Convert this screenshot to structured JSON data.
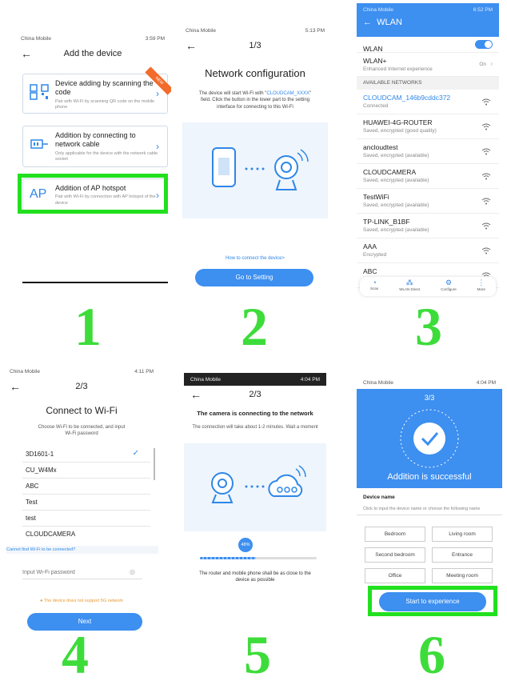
{
  "colors": {
    "accent": "#3d8ff0",
    "highlight": "#22e01f",
    "step_number": "#3ddc3a",
    "wlan_bar": "#3d8ff0"
  },
  "steps": {
    "s1": "1",
    "s2": "2",
    "s3": "3",
    "s4": "4",
    "s5": "5",
    "s6": "6"
  },
  "p1": {
    "carrier": "China Mobile",
    "time": "3:59 PM",
    "title": "Add the device",
    "cards": [
      {
        "title": "Device adding by scanning the code",
        "sub": "Pair with Wi-Fi by scanning QR code on the mobile phone",
        "badge": "NEW"
      },
      {
        "title": "Addition by connecting to network cable",
        "sub": "Only applicable for the device with the network cable socket"
      },
      {
        "title": "Addition of AP hotspot",
        "sub": "Pair with Wi-Fi by connection with AP hotspot of the device",
        "icon_text": "AP"
      }
    ]
  },
  "p2": {
    "carrier": "China Mobile",
    "time": "5:13 PM",
    "step": "1/3",
    "title": "Network configuration",
    "desc_pre": "The device will start Wi-Fi with \"",
    "desc_ssid": "CLOUDCAM_XXXX",
    "desc_post": "\" field. Click the button in the lower part to the setting interface for connecting to this Wi-Fi",
    "link": "How to connect the device>",
    "button": "Go to Setting"
  },
  "p3": {
    "carrier": "China Mobile",
    "time": "6:52 PM",
    "title": "WLAN",
    "wlan_label": "WLAN",
    "wlan_plus": "WLAN+",
    "wlan_plus_sub": "Enhanced Internet experience",
    "wlan_plus_val": "On",
    "section": "AVAILABLE NETWORKS",
    "networks": [
      {
        "name": "CLOUDCAM_146b9cddc372",
        "status": "Connected"
      },
      {
        "name": "HUAWEI-4G-ROUTER",
        "status": "Saved, encrypted (good quality)"
      },
      {
        "name": "ancloudtest",
        "status": "Saved, encrypted (available)"
      },
      {
        "name": "CLOUDCAMERA",
        "status": "Saved, encrypted (available)"
      },
      {
        "name": "TestWiFi",
        "status": "Saved, encrypted (available)"
      },
      {
        "name": "TP-LINK_B1BF",
        "status": "Saved, encrypted (available)"
      },
      {
        "name": "AAA",
        "status": "Encrypted"
      },
      {
        "name": "ABC",
        "status": "Encrypted"
      }
    ],
    "toolbar": {
      "scan": "Scan",
      "direct": "WLAN Direct",
      "configure": "Configure",
      "more": "More"
    }
  },
  "p4": {
    "carrier": "China Mobile",
    "time": "4:11 PM",
    "step": "2/3",
    "title": "Connect to Wi-Fi",
    "desc": "Choose Wi-Fi to be connected, and input Wi-Fi password",
    "wifi": [
      "3D1601-1",
      "CU_W4Mx",
      "ABC",
      "Test",
      "test",
      "CLOUDCAMERA"
    ],
    "cannot_find": "Cannot find Wi-Fi to be connected?",
    "password_placeholder": "Input Wi-Fi password",
    "warning": "The device does not support 5G network",
    "button": "Next"
  },
  "p5": {
    "carrier": "China Mobile",
    "time": "4:04 PM",
    "step": "2/3",
    "title": "The camera is connecting to the network",
    "sub": "The connection will take about 1-2 minutes. Wait a moment",
    "progress_label": "48%",
    "progress": 0.48,
    "note": "The router and mobile phone shall be as close to the device as possible"
  },
  "p6": {
    "carrier": "China Mobile",
    "time": "4:04 PM",
    "step": "3/3",
    "success": "Addition is successful",
    "device_name_label": "Device name",
    "device_name_hint": "Click to input the device name or choose the following name",
    "rooms": [
      "Bedroom",
      "Living room",
      "Second bedroom",
      "Entrance",
      "Office",
      "Meeting room"
    ],
    "button": "Start to experience"
  }
}
